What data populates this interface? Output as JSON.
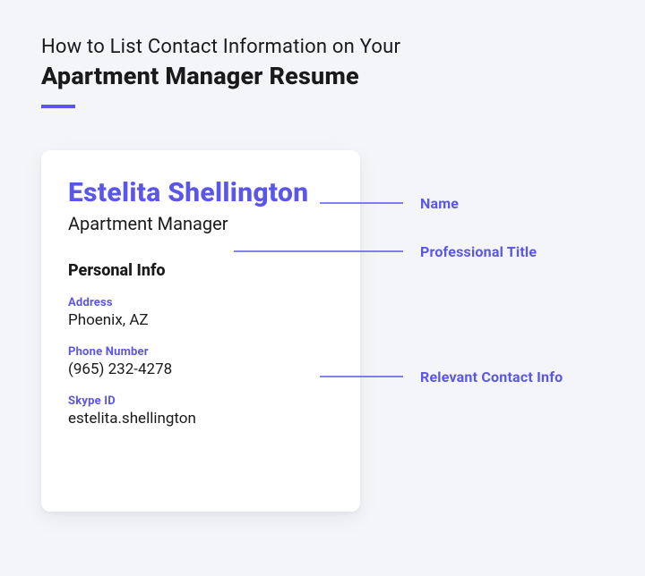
{
  "heading": {
    "light_line": "How to List Contact Information on Your",
    "bold_line": "Apartment Manager Resume"
  },
  "card": {
    "name": "Estelita Shellington",
    "job_title": "Apartment Manager",
    "section_title": "Personal Info",
    "address": {
      "label": "Address",
      "value": "Phoenix, AZ"
    },
    "phone": {
      "label": "Phone Number",
      "value": "(965) 232-4278"
    },
    "skype": {
      "label": "Skype ID",
      "value": "estelita.shellington"
    }
  },
  "annotations": {
    "name": "Name",
    "title": "Professional Title",
    "contact": "Relevant Contact Info"
  }
}
